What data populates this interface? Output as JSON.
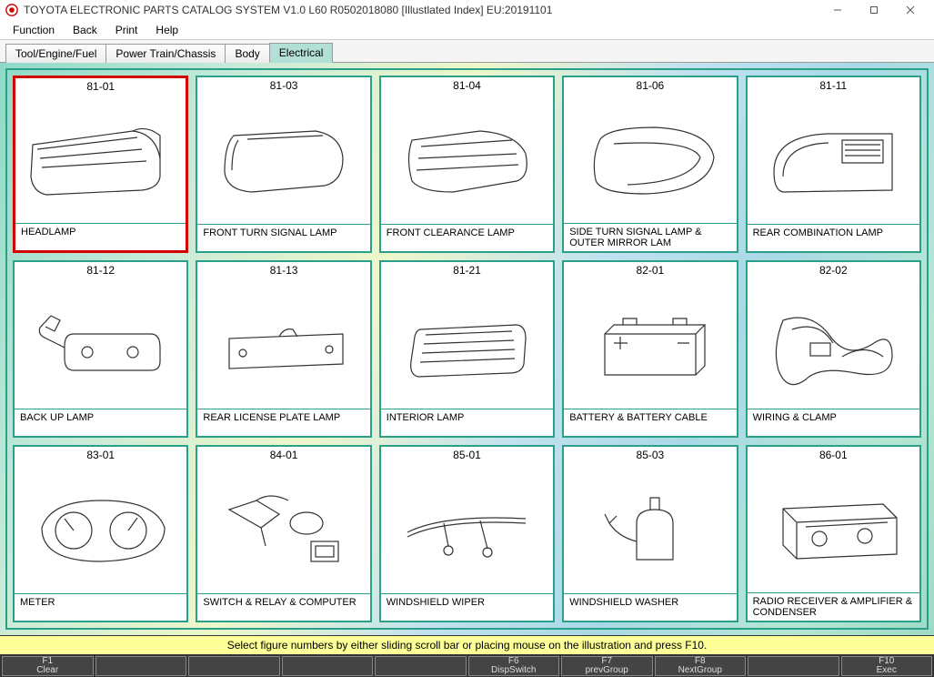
{
  "window": {
    "title": "TOYOTA ELECTRONIC PARTS CATALOG SYSTEM V1.0 L60 R0502018080 [Illustlated Index] EU:20191101"
  },
  "menu": [
    {
      "label": "Function"
    },
    {
      "label": "Back"
    },
    {
      "label": "Print"
    },
    {
      "label": "Help"
    }
  ],
  "tabs": [
    {
      "label": "Tool/Engine/Fuel",
      "active": false
    },
    {
      "label": "Power Train/Chassis",
      "active": false
    },
    {
      "label": "Body",
      "active": false
    },
    {
      "label": "Electrical",
      "active": true
    }
  ],
  "grid": {
    "columns": 5,
    "rows": 3,
    "items": [
      {
        "code": "81-01",
        "name": "HEADLAMP",
        "selected": true,
        "icon": "headlamp"
      },
      {
        "code": "81-03",
        "name": "FRONT TURN SIGNAL LAMP",
        "selected": false,
        "icon": "turn-signal"
      },
      {
        "code": "81-04",
        "name": "FRONT CLEARANCE LAMP",
        "selected": false,
        "icon": "clearance-lamp"
      },
      {
        "code": "81-06",
        "name": "SIDE TURN SIGNAL LAMP & OUTER MIRROR LAM",
        "selected": false,
        "icon": "side-mirror-lamp"
      },
      {
        "code": "81-11",
        "name": "REAR COMBINATION LAMP",
        "selected": false,
        "icon": "rear-combo-lamp"
      },
      {
        "code": "81-12",
        "name": "BACK UP LAMP",
        "selected": false,
        "icon": "backup-lamp"
      },
      {
        "code": "81-13",
        "name": "REAR LICENSE PLATE LAMP",
        "selected": false,
        "icon": "license-lamp"
      },
      {
        "code": "81-21",
        "name": "INTERIOR LAMP",
        "selected": false,
        "icon": "interior-lamp"
      },
      {
        "code": "82-01",
        "name": "BATTERY & BATTERY CABLE",
        "selected": false,
        "icon": "battery"
      },
      {
        "code": "82-02",
        "name": "WIRING & CLAMP",
        "selected": false,
        "icon": "wiring"
      },
      {
        "code": "83-01",
        "name": "METER",
        "selected": false,
        "icon": "meter"
      },
      {
        "code": "84-01",
        "name": "SWITCH & RELAY & COMPUTER",
        "selected": false,
        "icon": "switch-relay"
      },
      {
        "code": "85-01",
        "name": "WINDSHIELD WIPER",
        "selected": false,
        "icon": "wiper"
      },
      {
        "code": "85-03",
        "name": "WINDSHIELD WASHER",
        "selected": false,
        "icon": "washer"
      },
      {
        "code": "86-01",
        "name": "RADIO RECEIVER & AMPLIFIER & CONDENSER",
        "selected": false,
        "icon": "radio"
      }
    ]
  },
  "hint": "Select figure numbers by either sliding scroll bar or placing mouse on the illustration and press F10.",
  "fkeys": [
    {
      "key": "F1",
      "label": "Clear"
    },
    {
      "key": "",
      "label": ""
    },
    {
      "key": "",
      "label": ""
    },
    {
      "key": "",
      "label": ""
    },
    {
      "key": "",
      "label": ""
    },
    {
      "key": "F6",
      "label": "DispSwitch"
    },
    {
      "key": "F7",
      "label": "prevGroup"
    },
    {
      "key": "F8",
      "label": "NextGroup"
    },
    {
      "key": "",
      "label": ""
    },
    {
      "key": "F10",
      "label": "Exec"
    }
  ]
}
